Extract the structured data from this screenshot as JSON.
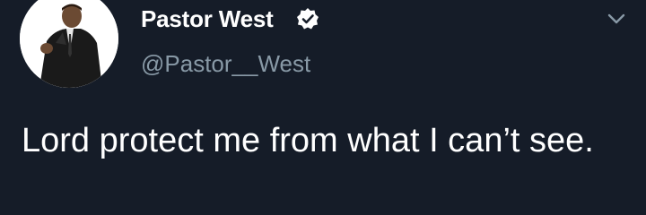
{
  "tweet": {
    "display_name": "Pastor West",
    "handle": "@Pastor__West",
    "text": "Lord protect me from what I can’t see."
  },
  "icons": {
    "verified": "verified-badge-icon",
    "menu": "chevron-down-icon"
  },
  "colors": {
    "background": "#151c28",
    "text": "#ffffff",
    "secondary_text": "#8899a6"
  }
}
